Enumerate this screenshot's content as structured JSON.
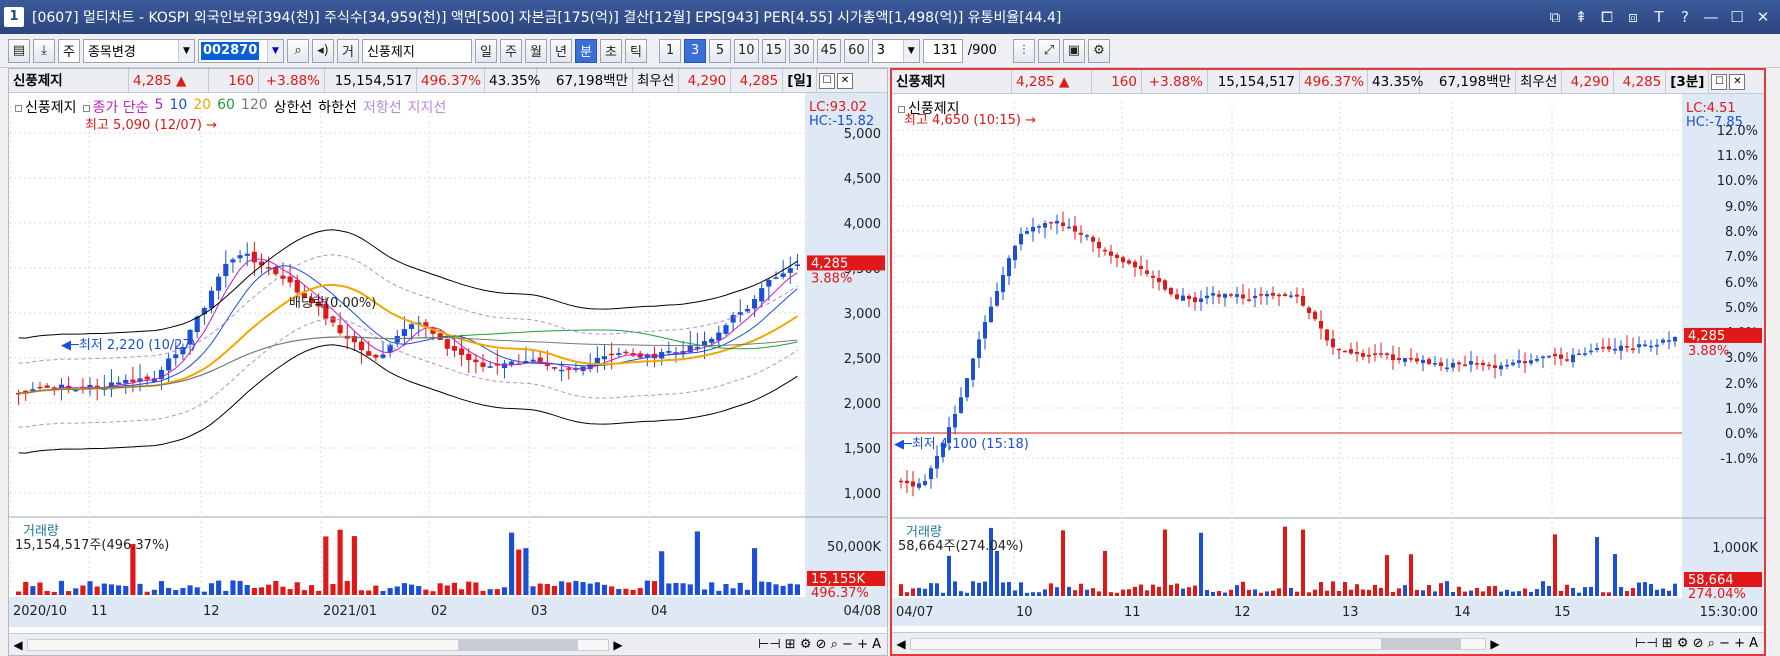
{
  "window": {
    "number": "1",
    "title": "[0607] 멀티차트 - KOSPI 외국인보유[394(천)] 주식수[34,959(천)] 액면[500] 자본금[175(억)] 결산[12월] EPS[943] PER[4.55] 시가총액[1,498(억)] 유통비율[44.4]",
    "controls": [
      "⧉",
      "⇞",
      "⧠",
      "⧈",
      "T",
      "?",
      "—",
      "☐",
      "✕"
    ]
  },
  "toolbar": {
    "mode_select": "주",
    "change_stock": "종목변경",
    "stock_code": "002870",
    "market_tag": "거",
    "stock_name": "신풍제지",
    "periods": [
      "일",
      "주",
      "월",
      "년",
      "분",
      "초",
      "틱"
    ],
    "selected_period": "분",
    "intervals": [
      "1",
      "3",
      "5",
      "10",
      "15",
      "30",
      "45",
      "60"
    ],
    "selected_interval": "3",
    "count_value": "3",
    "view_count": "131",
    "view_total": "/900"
  },
  "left": {
    "name": "신풍제지",
    "price": "4,285",
    "change": "160",
    "change_pct": "+3.88%",
    "volume": "15,154,517",
    "vol_ratio": "496.37%",
    "turnover": "43.35%",
    "amount": "67,198백만",
    "best_label": "최우선",
    "ask": "4,290",
    "bid": "4,285",
    "period_tag": "[일]",
    "legend": [
      "신풍제지",
      "종가 단순",
      "5",
      "10",
      "20",
      "60",
      "120",
      "상한선",
      "하한선",
      "저항선",
      "지지선"
    ],
    "lc": "LC:93.02",
    "hc": "HC:-15.82",
    "y_ticks": [
      "5,000",
      "4,500",
      "4,000",
      "3,500",
      "3,000",
      "2,500",
      "2,000",
      "1,500",
      "1,000"
    ],
    "price_tag": "4,285",
    "price_tag_pct": "3.88%",
    "high_label": "최고 5,090 (12/07)",
    "low_label": "최저 2,220 (10/27)",
    "dividend_label": "배당락(0.00%)",
    "vol_label": "거래량",
    "vol_value": "15,154,517주(496.37%)",
    "vol_tick": "50,000K",
    "vol_tag": "15,155K",
    "vol_tag_pct": "496.37%",
    "x_ticks": [
      "2020/10",
      "11",
      "12",
      "2021/01",
      "02",
      "03",
      "04"
    ],
    "x_right": "04/08"
  },
  "right": {
    "name": "신풍제지",
    "price": "4,285",
    "change": "160",
    "change_pct": "+3.88%",
    "volume": "15,154,517",
    "vol_ratio": "496.37%",
    "turnover": "43.35%",
    "amount": "67,198백만",
    "best_label": "최우선",
    "ask": "4,290",
    "bid": "4,285",
    "period_tag": "[3분]",
    "legend": [
      "신풍제지"
    ],
    "lc": "LC:4.51",
    "hc": "HC:-7.85",
    "y_ticks": [
      "12.0%",
      "11.0%",
      "10.0%",
      "9.0%",
      "8.0%",
      "7.0%",
      "6.0%",
      "5.0%",
      "4.0%",
      "3.0%",
      "2.0%",
      "1.0%",
      "0.0%",
      "-1.0%"
    ],
    "price_tag": "4,285",
    "price_tag_pct": "3.88%",
    "high_label": "최고 4,650 (10:15)",
    "low_label": "최저 4,100 (15:18)",
    "vol_label": "거래량",
    "vol_value": "58,664주(274.04%)",
    "vol_tick": "1,000K",
    "vol_tag": "58,664",
    "vol_tag_pct": "274.04%",
    "x_ticks": [
      "04/07",
      "10",
      "11",
      "12",
      "13",
      "14",
      "15"
    ],
    "x_right": "15:30:00"
  },
  "colors": {
    "up": "#e01818",
    "down": "#1a4fd6",
    "ma5": "#1a4fd6",
    "ma10": "#1a4fd6",
    "ma20": "#f0a800",
    "ma60": "#1f9d3a",
    "ma120": "#777777",
    "band": "#000000"
  }
}
